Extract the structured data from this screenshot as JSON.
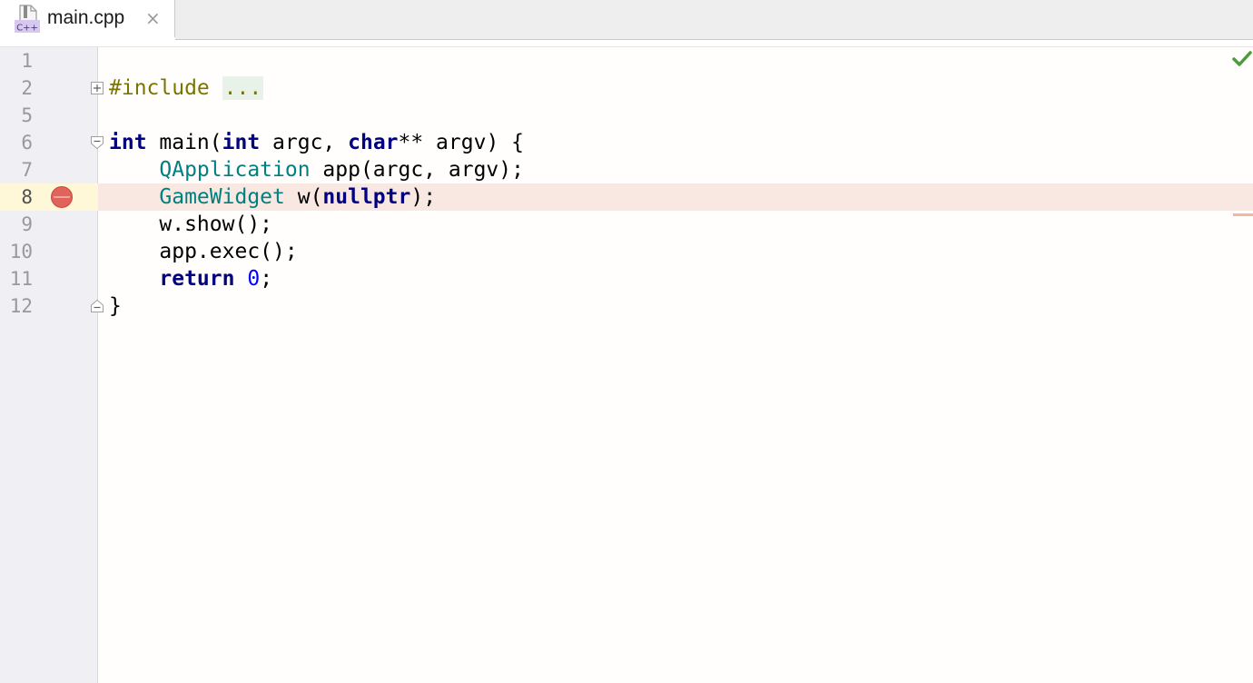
{
  "tab": {
    "filename": "main.cpp",
    "icon_label": "C++",
    "close_glyph": "×"
  },
  "gutter": {
    "line_numbers": [
      "1",
      "2",
      "5",
      "6",
      "7",
      "8",
      "9",
      "10",
      "11",
      "12"
    ]
  },
  "code": {
    "line2_pp": "#include",
    "line2_folded": "...",
    "line6_kw1": "int",
    "line6_mid1": " main(",
    "line6_kw2": "int",
    "line6_mid2": " argc, ",
    "line6_kw3": "char",
    "line6_rest": "** argv) {",
    "line7_indent": "    ",
    "line7_type": "QApplication",
    "line7_rest": " app(argc, argv);",
    "line8_indent": "    ",
    "line8_type": "GameWidget",
    "line8_mid": " w(",
    "line8_kw": "nullptr",
    "line8_rest": ");",
    "line9": "    w.show();",
    "line10": "    app.exec();",
    "line11_indent": "    ",
    "line11_kw": "return",
    "line11_sp": " ",
    "line11_num": "0",
    "line11_rest": ";",
    "line12": "}"
  },
  "status": {
    "inspection_icon": "checkmark-icon",
    "breakpoint_line": "8"
  },
  "colors": {
    "keyword": "#000080",
    "preprocessor": "#7b7400",
    "type": "#008080",
    "number": "#0000ff",
    "breakpoint": "#e0645a",
    "breakpoint_line_bg": "#f9e8e2",
    "inspection_ok": "#4f9a3f"
  }
}
